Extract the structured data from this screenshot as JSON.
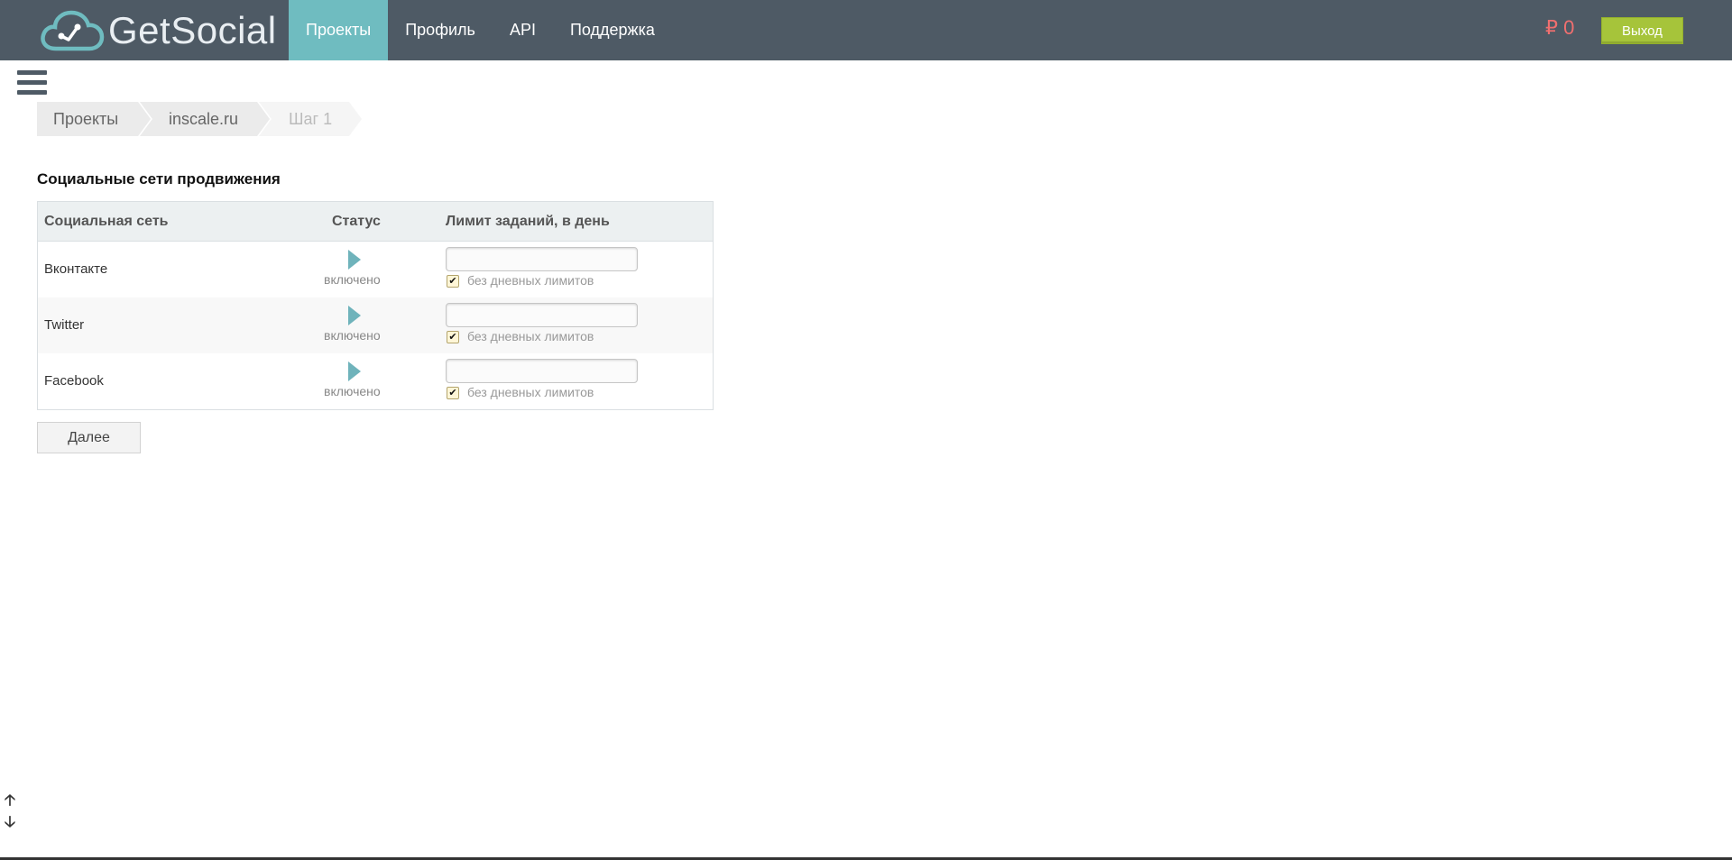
{
  "header": {
    "logo_text": "GetSocial",
    "nav": [
      {
        "label": "Проекты",
        "active": true
      },
      {
        "label": "Профиль",
        "active": false
      },
      {
        "label": "API",
        "active": false
      },
      {
        "label": "Поддержка",
        "active": false
      }
    ],
    "balance": "₽ 0",
    "logout_label": "Выход",
    "colors": {
      "bar": "#4e5a65",
      "active_tab": "#6fbcc0",
      "logout": "#a6c43a",
      "balance": "#f06f6f"
    }
  },
  "menu_icon": "hamburger-icon",
  "breadcrumb": [
    "Проекты",
    "inscale.ru",
    "Шаг 1"
  ],
  "section": {
    "title": "Социальные сети продвижения",
    "columns": [
      "Социальная сеть",
      "Статус",
      "Лимит заданий, в день"
    ],
    "rows": [
      {
        "network": "Вконтакте",
        "status": "включено",
        "limit_value": "",
        "no_limit_checked": true,
        "no_limit_label": "без дневных лимитов"
      },
      {
        "network": "Twitter",
        "status": "включено",
        "limit_value": "",
        "no_limit_checked": true,
        "no_limit_label": "без дневных лимитов"
      },
      {
        "network": "Facebook",
        "status": "включено",
        "limit_value": "",
        "no_limit_checked": true,
        "no_limit_label": "без дневных лимитов"
      }
    ]
  },
  "next_label": "Далее",
  "scroll_icons": [
    "arrow-up-icon",
    "arrow-down-icon"
  ]
}
